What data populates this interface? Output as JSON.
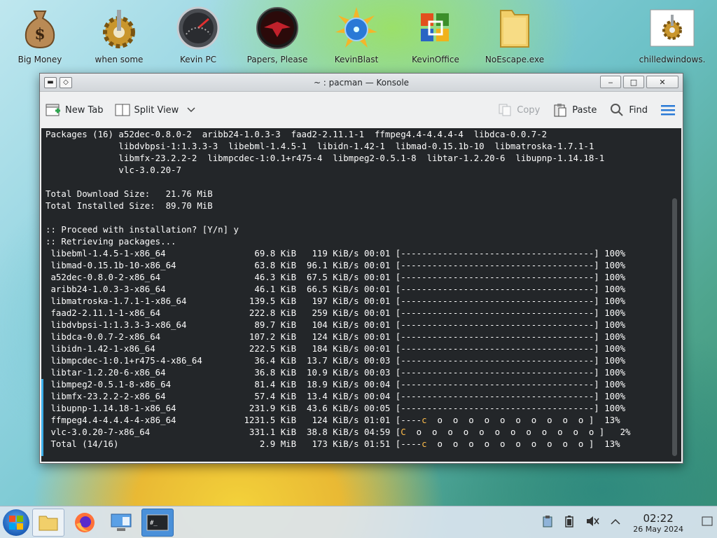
{
  "desktop_icons": [
    {
      "label": "Big Money",
      "icon": "money-bag-icon"
    },
    {
      "label": "when some",
      "icon": "gear-icon"
    },
    {
      "label": "Kevin PC",
      "icon": "gauge-icon"
    },
    {
      "label": "Papers, Please",
      "icon": "eagle-emblem-icon"
    },
    {
      "label": "KevinBlast",
      "icon": "starburst-disc-icon"
    },
    {
      "label": "KevinOffice",
      "icon": "office-logo-icon"
    },
    {
      "label": "NoEscape.exe",
      "icon": "folder-icon"
    },
    {
      "label": "chilledwindows.",
      "icon": "gear-file-icon"
    }
  ],
  "window": {
    "title": "~ : pacman — Konsole",
    "buttons": {
      "minimize": "‒",
      "maximize": "□",
      "close": "✕"
    }
  },
  "toolbar": {
    "new_tab": "New Tab",
    "split_view": "Split View",
    "copy": "Copy",
    "paste": "Paste",
    "find": "Find"
  },
  "terminal": {
    "lines": [
      "Packages (16) a52dec-0.8.0-2  aribb24-1.0.3-3  faad2-2.11.1-1  ffmpeg4.4-4.4.4-4  libdca-0.0.7-2",
      "              libdvbpsi-1:1.3.3-3  libebml-1.4.5-1  libidn-1.42-1  libmad-0.15.1b-10  libmatroska-1.7.1-1",
      "              libmfx-23.2.2-2  libmpcdec-1:0.1+r475-4  libmpeg2-0.5.1-8  libtar-1.2.20-6  libupnp-1.14.18-1",
      "              vlc-3.0.20-7",
      "",
      "Total Download Size:   21.76 MiB",
      "Total Installed Size:  89.70 MiB",
      "",
      ":: Proceed with installation? [Y/n] y",
      ":: Retrieving packages...",
      " libebml-1.4.5-1-x86_64                 69.8 KiB   119 KiB/s 00:01 [-------------------------------------] 100%",
      " libmad-0.15.1b-10-x86_64               63.8 KiB  96.1 KiB/s 00:01 [-------------------------------------] 100%",
      " a52dec-0.8.0-2-x86_64                  46.3 KiB  67.5 KiB/s 00:01 [-------------------------------------] 100%",
      " aribb24-1.0.3-3-x86_64                 46.1 KiB  66.5 KiB/s 00:01 [-------------------------------------] 100%",
      " libmatroska-1.7.1-1-x86_64            139.5 KiB   197 KiB/s 00:01 [-------------------------------------] 100%",
      " faad2-2.11.1-1-x86_64                 222.8 KiB   259 KiB/s 00:01 [-------------------------------------] 100%",
      " libdvbpsi-1:1.3.3-3-x86_64             89.7 KiB   104 KiB/s 00:01 [-------------------------------------] 100%",
      " libdca-0.0.7-2-x86_64                 107.2 KiB   124 KiB/s 00:01 [-------------------------------------] 100%",
      " libidn-1.42-1-x86_64                  222.5 KiB   184 KiB/s 00:01 [-------------------------------------] 100%",
      " libmpcdec-1:0.1+r475-4-x86_64          36.4 KiB  13.7 KiB/s 00:03 [-------------------------------------] 100%",
      " libtar-1.2.20-6-x86_64                 36.8 KiB  10.9 KiB/s 00:03 [-------------------------------------] 100%",
      " libmpeg2-0.5.1-8-x86_64                81.4 KiB  18.9 KiB/s 00:04 [-------------------------------------] 100%",
      " libmfx-23.2.2-2-x86_64                 57.4 KiB  13.4 KiB/s 00:04 [-------------------------------------] 100%",
      " libupnp-1.14.18-1-x86_64              231.9 KiB  43.6 KiB/s 00:05 [-------------------------------------] 100%"
    ],
    "progress_lines": [
      {
        "pre": " ffmpeg4.4-4.4.4-4-x86_64             1231.5 KiB   124 KiB/s 01:01 [----",
        "pac": "c",
        "post": "  o  o  o  o  o  o  o  o  o  o ]  13%"
      },
      {
        "pre": " vlc-3.0.20-7-x86_64                   331.1 KiB  38.8 KiB/s 04:59 [",
        "pac": "C",
        "post": "  o  o  o  o  o  o  o  o  o  o  o  o ]   2%"
      },
      {
        "pre": " Total (14/16)                           2.9 MiB   173 KiB/s 01:51 [----",
        "pac": "c",
        "post": "  o  o  o  o  o  o  o  o  o  o ]  13%"
      }
    ]
  },
  "taskbar": {
    "tasks": [
      "file-manager-icon",
      "firefox-icon",
      "system-settings-icon",
      "konsole-icon"
    ],
    "tray": [
      "clipboard-icon",
      "battery-icon",
      "volume-muted-icon",
      "chevron-up-icon"
    ],
    "time": "02:22",
    "date": "26 May 2024"
  }
}
